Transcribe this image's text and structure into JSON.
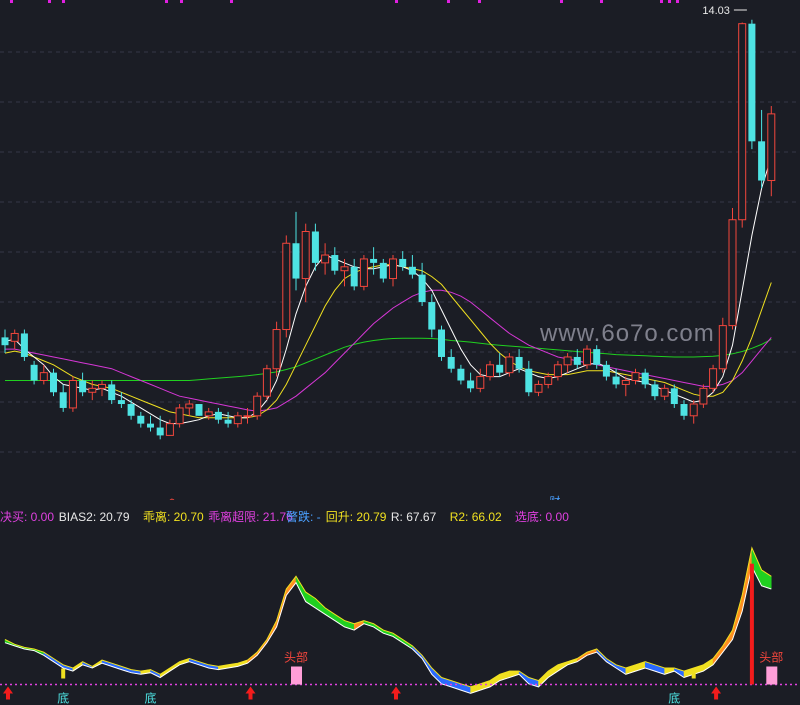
{
  "chart_data": [
    {
      "type": "candlestick",
      "price_label": "14.03",
      "marker_s": "$",
      "marker_cai": "财",
      "watermark": "www.6o7o.com",
      "colors": {
        "up": "#f2463c",
        "down": "#4ee3e3",
        "ma5": "#ffffff",
        "ma10": "#f0e020",
        "ma20": "#d637d6",
        "ma60": "#20d020",
        "dots": "#e020e0"
      },
      "ylim": [
        3.0,
        14.4
      ],
      "candles": [
        [
          6.0,
          6.2,
          5.6,
          5.8
        ],
        [
          5.9,
          6.2,
          5.7,
          6.1
        ],
        [
          6.1,
          6.2,
          5.4,
          5.5
        ],
        [
          5.3,
          5.4,
          4.8,
          4.9
        ],
        [
          4.9,
          5.3,
          4.8,
          5.1
        ],
        [
          5.1,
          5.2,
          4.5,
          4.6
        ],
        [
          4.6,
          4.8,
          4.1,
          4.2
        ],
        [
          4.2,
          5.0,
          4.1,
          4.9
        ],
        [
          4.9,
          5.1,
          4.5,
          4.6
        ],
        [
          4.6,
          4.9,
          4.4,
          4.7
        ],
        [
          4.7,
          4.9,
          4.5,
          4.8
        ],
        [
          4.8,
          4.9,
          4.3,
          4.4
        ],
        [
          4.4,
          4.6,
          4.2,
          4.3
        ],
        [
          4.3,
          4.4,
          3.9,
          4.0
        ],
        [
          4.0,
          4.1,
          3.7,
          3.8
        ],
        [
          3.8,
          4.0,
          3.6,
          3.7
        ],
        [
          3.7,
          4.0,
          3.4,
          3.5
        ],
        [
          3.5,
          3.9,
          3.5,
          3.8
        ],
        [
          3.8,
          4.3,
          3.7,
          4.2
        ],
        [
          4.2,
          4.4,
          4.0,
          4.3
        ],
        [
          4.3,
          4.3,
          4.0,
          4.0
        ],
        [
          4.0,
          4.2,
          3.9,
          4.1
        ],
        [
          4.1,
          4.2,
          3.8,
          3.9
        ],
        [
          3.9,
          4.1,
          3.7,
          3.8
        ],
        [
          3.8,
          4.1,
          3.7,
          4.0
        ],
        [
          4.0,
          4.2,
          3.8,
          4.0
        ],
        [
          4.0,
          4.6,
          3.9,
          4.5
        ],
        [
          4.5,
          5.3,
          4.4,
          5.2
        ],
        [
          5.2,
          6.4,
          5.0,
          6.2
        ],
        [
          6.2,
          8.6,
          6.0,
          8.4
        ],
        [
          8.4,
          9.2,
          7.2,
          7.5
        ],
        [
          7.5,
          8.9,
          6.9,
          8.7
        ],
        [
          8.7,
          8.9,
          7.7,
          7.9
        ],
        [
          7.9,
          8.4,
          7.6,
          8.1
        ],
        [
          8.1,
          8.3,
          7.6,
          7.7
        ],
        [
          7.7,
          8.0,
          7.3,
          7.8
        ],
        [
          7.8,
          8.0,
          7.2,
          7.3
        ],
        [
          7.3,
          8.1,
          7.2,
          8.0
        ],
        [
          8.0,
          8.3,
          7.6,
          7.9
        ],
        [
          7.9,
          8.0,
          7.4,
          7.5
        ],
        [
          7.5,
          8.1,
          7.3,
          8.0
        ],
        [
          8.0,
          8.2,
          7.7,
          7.8
        ],
        [
          7.8,
          8.1,
          7.5,
          7.6
        ],
        [
          7.6,
          7.9,
          6.8,
          6.9
        ],
        [
          6.9,
          7.1,
          6.0,
          6.2
        ],
        [
          6.2,
          6.3,
          5.4,
          5.5
        ],
        [
          5.5,
          5.7,
          5.1,
          5.2
        ],
        [
          5.2,
          5.3,
          4.8,
          4.9
        ],
        [
          4.9,
          5.1,
          4.6,
          4.7
        ],
        [
          4.7,
          5.2,
          4.6,
          5.0
        ],
        [
          5.0,
          5.4,
          4.9,
          5.3
        ],
        [
          5.3,
          5.6,
          5.0,
          5.1
        ],
        [
          5.1,
          5.6,
          5.0,
          5.5
        ],
        [
          5.5,
          5.7,
          5.1,
          5.2
        ],
        [
          5.2,
          5.4,
          4.5,
          4.6
        ],
        [
          4.6,
          4.9,
          4.5,
          4.8
        ],
        [
          4.8,
          5.1,
          4.7,
          5.0
        ],
        [
          5.0,
          5.4,
          4.9,
          5.3
        ],
        [
          5.3,
          5.6,
          5.1,
          5.5
        ],
        [
          5.5,
          5.7,
          5.2,
          5.3
        ],
        [
          5.3,
          5.8,
          5.2,
          5.7
        ],
        [
          5.7,
          5.8,
          5.2,
          5.3
        ],
        [
          5.3,
          5.4,
          4.9,
          5.0
        ],
        [
          5.0,
          5.2,
          4.7,
          4.8
        ],
        [
          4.8,
          5.0,
          4.5,
          4.9
        ],
        [
          4.9,
          5.2,
          4.8,
          5.1
        ],
        [
          5.1,
          5.2,
          4.7,
          4.8
        ],
        [
          4.8,
          4.9,
          4.4,
          4.5
        ],
        [
          4.5,
          4.8,
          4.4,
          4.7
        ],
        [
          4.7,
          4.8,
          4.2,
          4.3
        ],
        [
          4.3,
          4.4,
          3.9,
          4.0
        ],
        [
          4.0,
          4.4,
          3.8,
          4.3
        ],
        [
          4.3,
          4.8,
          4.2,
          4.7
        ],
        [
          4.7,
          5.3,
          4.6,
          5.2
        ],
        [
          5.2,
          6.5,
          5.1,
          6.3
        ],
        [
          6.3,
          9.3,
          6.2,
          9.0
        ],
        [
          9.0,
          14.03,
          8.8,
          14.0
        ],
        [
          14.0,
          14.1,
          10.8,
          11.0
        ],
        [
          11.0,
          11.8,
          9.8,
          10.0
        ],
        [
          10.0,
          11.9,
          9.6,
          11.7
        ]
      ],
      "ma5": [
        5.9,
        5.95,
        5.7,
        5.5,
        5.3,
        5.0,
        4.8,
        4.75,
        4.7,
        4.65,
        4.7,
        4.6,
        4.5,
        4.35,
        4.2,
        4.05,
        3.9,
        3.8,
        3.8,
        3.85,
        3.9,
        4.0,
        4.05,
        4.0,
        3.95,
        3.95,
        4.1,
        4.4,
        4.9,
        5.7,
        6.6,
        7.3,
        7.8,
        8.1,
        8.0,
        7.9,
        7.8,
        7.75,
        7.75,
        7.8,
        7.85,
        7.8,
        7.7,
        7.5,
        7.2,
        6.7,
        6.2,
        5.7,
        5.3,
        5.05,
        5.0,
        5.0,
        5.1,
        5.2,
        5.1,
        5.0,
        4.95,
        5.0,
        5.1,
        5.2,
        5.3,
        5.35,
        5.25,
        5.1,
        4.95,
        4.9,
        4.85,
        4.75,
        4.65,
        4.55,
        4.45,
        4.35,
        4.4,
        4.6,
        5.0,
        5.8,
        7.2,
        8.6,
        9.8,
        10.6
      ],
      "ma10": [
        5.6,
        5.65,
        5.6,
        5.5,
        5.4,
        5.3,
        5.15,
        5.0,
        4.9,
        4.8,
        4.75,
        4.7,
        4.6,
        4.5,
        4.4,
        4.3,
        4.2,
        4.1,
        4.05,
        4.0,
        3.95,
        3.95,
        3.95,
        3.95,
        3.95,
        3.95,
        4.0,
        4.15,
        4.4,
        4.8,
        5.3,
        5.8,
        6.3,
        6.8,
        7.2,
        7.5,
        7.65,
        7.75,
        7.8,
        7.85,
        7.85,
        7.8,
        7.75,
        7.7,
        7.55,
        7.35,
        7.05,
        6.75,
        6.45,
        6.15,
        5.85,
        5.6,
        5.4,
        5.25,
        5.15,
        5.1,
        5.05,
        5.05,
        5.05,
        5.1,
        5.15,
        5.15,
        5.15,
        5.1,
        5.05,
        5.0,
        4.95,
        4.9,
        4.85,
        4.75,
        4.65,
        4.55,
        4.5,
        4.5,
        4.6,
        4.9,
        5.4,
        6.0,
        6.7,
        7.4
      ],
      "ma20": [
        5.7,
        5.7,
        5.65,
        5.6,
        5.55,
        5.5,
        5.45,
        5.4,
        5.35,
        5.3,
        5.25,
        5.2,
        5.1,
        5.0,
        4.9,
        4.8,
        4.7,
        4.6,
        4.5,
        4.45,
        4.4,
        4.35,
        4.3,
        4.25,
        4.2,
        4.15,
        4.12,
        4.15,
        4.2,
        4.35,
        4.5,
        4.7,
        4.9,
        5.1,
        5.35,
        5.6,
        5.85,
        6.1,
        6.35,
        6.55,
        6.75,
        6.9,
        7.05,
        7.15,
        7.2,
        7.2,
        7.15,
        7.05,
        6.9,
        6.7,
        6.5,
        6.3,
        6.1,
        5.95,
        5.8,
        5.7,
        5.6,
        5.5,
        5.45,
        5.4,
        5.35,
        5.3,
        5.25,
        5.2,
        5.15,
        5.1,
        5.05,
        5.0,
        4.95,
        4.9,
        4.85,
        4.8,
        4.75,
        4.75,
        4.8,
        4.9,
        5.1,
        5.4,
        5.7,
        6.0
      ],
      "ma60": [
        4.9,
        4.9,
        4.9,
        4.9,
        4.9,
        4.9,
        4.9,
        4.9,
        4.9,
        4.9,
        4.9,
        4.9,
        4.9,
        4.9,
        4.9,
        4.9,
        4.9,
        4.9,
        4.9,
        4.9,
        4.92,
        4.94,
        4.96,
        4.98,
        5.0,
        5.02,
        5.05,
        5.08,
        5.12,
        5.18,
        5.25,
        5.35,
        5.45,
        5.55,
        5.65,
        5.75,
        5.82,
        5.88,
        5.92,
        5.95,
        5.97,
        5.98,
        5.98,
        5.98,
        5.97,
        5.95,
        5.92,
        5.9,
        5.88,
        5.85,
        5.82,
        5.8,
        5.78,
        5.76,
        5.74,
        5.72,
        5.7,
        5.68,
        5.66,
        5.64,
        5.62,
        5.6,
        5.58,
        5.56,
        5.55,
        5.54,
        5.53,
        5.52,
        5.51,
        5.5,
        5.5,
        5.5,
        5.51,
        5.52,
        5.54,
        5.58,
        5.64,
        5.72,
        5.82,
        5.95
      ]
    },
    {
      "type": "indicator",
      "legend": [
        {
          "label": "决买: 0.00",
          "color": "#e040e0"
        },
        {
          "label": "BIAS2: 20.79",
          "color": "#e8e8e8"
        },
        {
          "label": "乖离: 20.70",
          "color": "#f0e020"
        },
        {
          "label": "乖离超限: 21.76",
          "color": "#e040e0"
        },
        {
          "label": "警跌: -",
          "color": "#4aa0ff"
        },
        {
          "label": "回升: 20.79",
          "color": "#f0e020"
        },
        {
          "label": "R: 67.67",
          "color": "#e8e8e8"
        },
        {
          "label": "R2: 66.02",
          "color": "#f0e020"
        },
        {
          "label": "选底: 0.00",
          "color": "#e040e0"
        }
      ],
      "tops": [
        {
          "i": 30,
          "text": "头部"
        },
        {
          "i": 79,
          "text": "头部"
        }
      ],
      "bottoms": [
        {
          "i": 6,
          "text": "底"
        },
        {
          "i": 15,
          "text": "底"
        },
        {
          "i": 69,
          "text": "底"
        }
      ],
      "buy_arrows": [
        0,
        25,
        40,
        73
      ],
      "values": [
        10,
        8,
        6,
        5,
        2,
        -2,
        -6,
        -8,
        -4,
        -6,
        -3,
        -5,
        -7,
        -9,
        -10,
        -9,
        -12,
        -8,
        -4,
        -2,
        -4,
        -6,
        -7,
        -6,
        -5,
        -3,
        2,
        10,
        20,
        40,
        48,
        36,
        32,
        28,
        24,
        20,
        18,
        22,
        20,
        16,
        14,
        10,
        6,
        0,
        -10,
        -16,
        -18,
        -20,
        -22,
        -20,
        -18,
        -14,
        -12,
        -10,
        -16,
        -18,
        -12,
        -8,
        -4,
        -2,
        2,
        4,
        -2,
        -6,
        -10,
        -8,
        -6,
        -8,
        -10,
        -8,
        -12,
        -10,
        -8,
        -4,
        4,
        12,
        30,
        58,
        46,
        44
      ],
      "values2": [
        12,
        9,
        7,
        6,
        4,
        0,
        -4,
        -6,
        -2,
        -5,
        -1,
        -3,
        -5,
        -7,
        -8,
        -7,
        -10,
        -6,
        -2,
        0,
        -2,
        -4,
        -5,
        -4,
        -3,
        -1,
        4,
        12,
        24,
        44,
        52,
        42,
        38,
        32,
        28,
        24,
        22,
        24,
        22,
        18,
        16,
        12,
        8,
        2,
        -6,
        -12,
        -14,
        -16,
        -18,
        -16,
        -14,
        -10,
        -8,
        -8,
        -12,
        -14,
        -8,
        -4,
        -2,
        0,
        4,
        6,
        0,
        -4,
        -6,
        -4,
        -2,
        -4,
        -6,
        -6,
        -8,
        -6,
        -4,
        0,
        8,
        18,
        40,
        70,
        56,
        52
      ],
      "ylim": [
        -25,
        75
      ]
    }
  ]
}
